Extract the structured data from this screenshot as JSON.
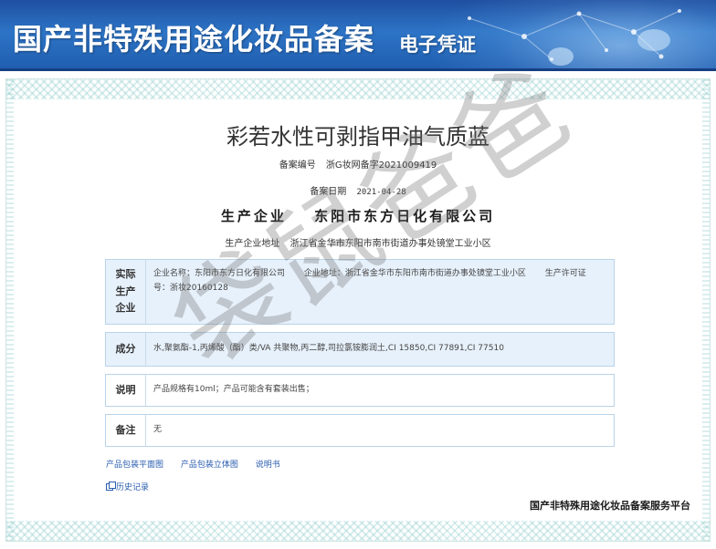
{
  "header": {
    "title": "国产非特殊用途化妆品备案",
    "subtitle": "电子凭证"
  },
  "certificate": {
    "product_name": "彩若水性可剥指甲油气质蓝",
    "record_number_label": "备案编号",
    "record_number": "浙G妆网备字2021009419",
    "record_date_label": "备案日期",
    "record_date": "2021-04-28",
    "manufacturer_label": "生产企业",
    "manufacturer": "东阳市东方日化有限公司",
    "address_label": "生产企业地址",
    "address": "浙江省金华市东阳市南市街道办事处镜堂工业小区"
  },
  "table": {
    "enterprise": {
      "label": "实际生产企业",
      "name": "企业名称：东阳市东方日化有限公司",
      "address": "企业地址：浙江省金华市东阳市南市街道办事处镜堂工业小区",
      "license": "生产许可证号：浙妆20160128"
    },
    "ingredients": {
      "label": "成分",
      "value": "水,聚氨酯-1,丙烯酸（酯）类/VA 共聚物,丙二醇,司拉氯铵膨润土,CI 15850,CI 77891,CI 77510"
    },
    "note": {
      "label": "说明",
      "value": "产品规格有10ml；产品可能含有套装出售；"
    },
    "remark": {
      "label": "备注",
      "value": "无"
    }
  },
  "links": {
    "flat_image": "产品包装平面图",
    "3d_image": "产品包装立体图",
    "manual": "说明书",
    "history": "历史记录"
  },
  "footer": {
    "platform": "国产非特殊用途化妆品备案服务平台"
  },
  "watermark": "袋鼠爸爸",
  "colors": {
    "banner": "#2d74c6",
    "table_shade": "#e7f1fb",
    "link": "#2a5db0"
  }
}
